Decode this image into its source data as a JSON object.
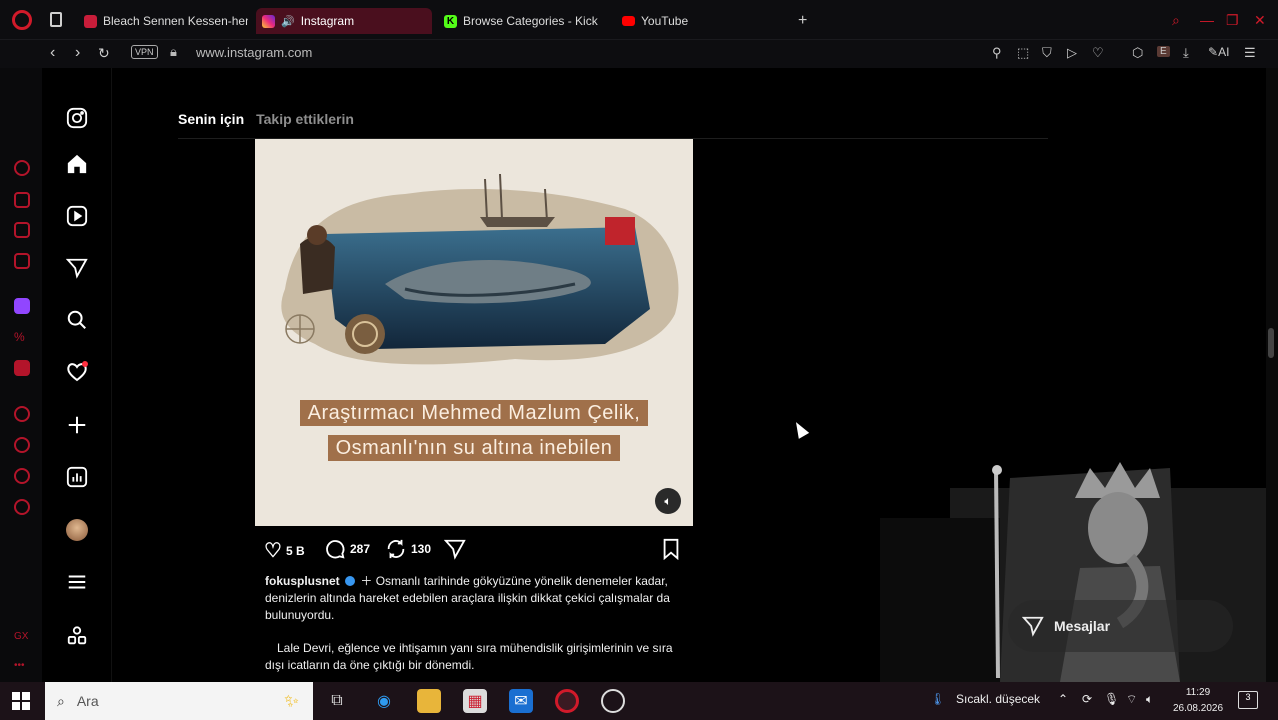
{
  "browser": {
    "tabs": [
      {
        "label": "Bleach Sennen Kessen-hen",
        "favicon_color": "#c81d3a"
      },
      {
        "label": "Instagram",
        "favicon_color": "#d6249f",
        "active": true
      },
      {
        "label": "Browse Categories - Kick",
        "favicon_color": "#53fc18"
      },
      {
        "label": "YouTube",
        "favicon_color": "#ff0000"
      }
    ],
    "new_tab": "+",
    "vpn_label": "VPN",
    "url": "www.instagram.com",
    "ai_label": "AI",
    "ext_badge": "E"
  },
  "instagram": {
    "feed_tabs": {
      "for_you": "Senin için",
      "following": "Takip ettiklerin"
    },
    "post": {
      "image_caption_line1": "Araştırmacı Mehmed Mazlum Çelik,",
      "image_caption_line2": "Osmanlı'nın su altına inebilen",
      "likes": "5 B",
      "comments": "287",
      "reposts": "130",
      "username": "fokusplusnet",
      "caption_p1": "Osmanlı tarihinde gökyüzüne yönelik denemeler kadar, denizlerin altında hareket edebilen araçlara ilişkin dikkat çekici çalışmalar da bulunuyordu.",
      "caption_p2": "Lale Devri, eğlence ve ihtişamın yanı sıra mühendislik girişimlerinin ve sıra dışı icatların da öne çıktığı bir dönemdi."
    },
    "messages_label": "Mesajlar"
  },
  "taskbar": {
    "search_placeholder": "Ara",
    "weather": "Sıcakl. düşecek",
    "time": "11:29",
    "date": "26.08.2026",
    "notification_count": "3"
  },
  "colors": {
    "opera_red": "#d11a2a",
    "active_tab": "#4a0f1e",
    "caption_band": "#a0704a"
  }
}
